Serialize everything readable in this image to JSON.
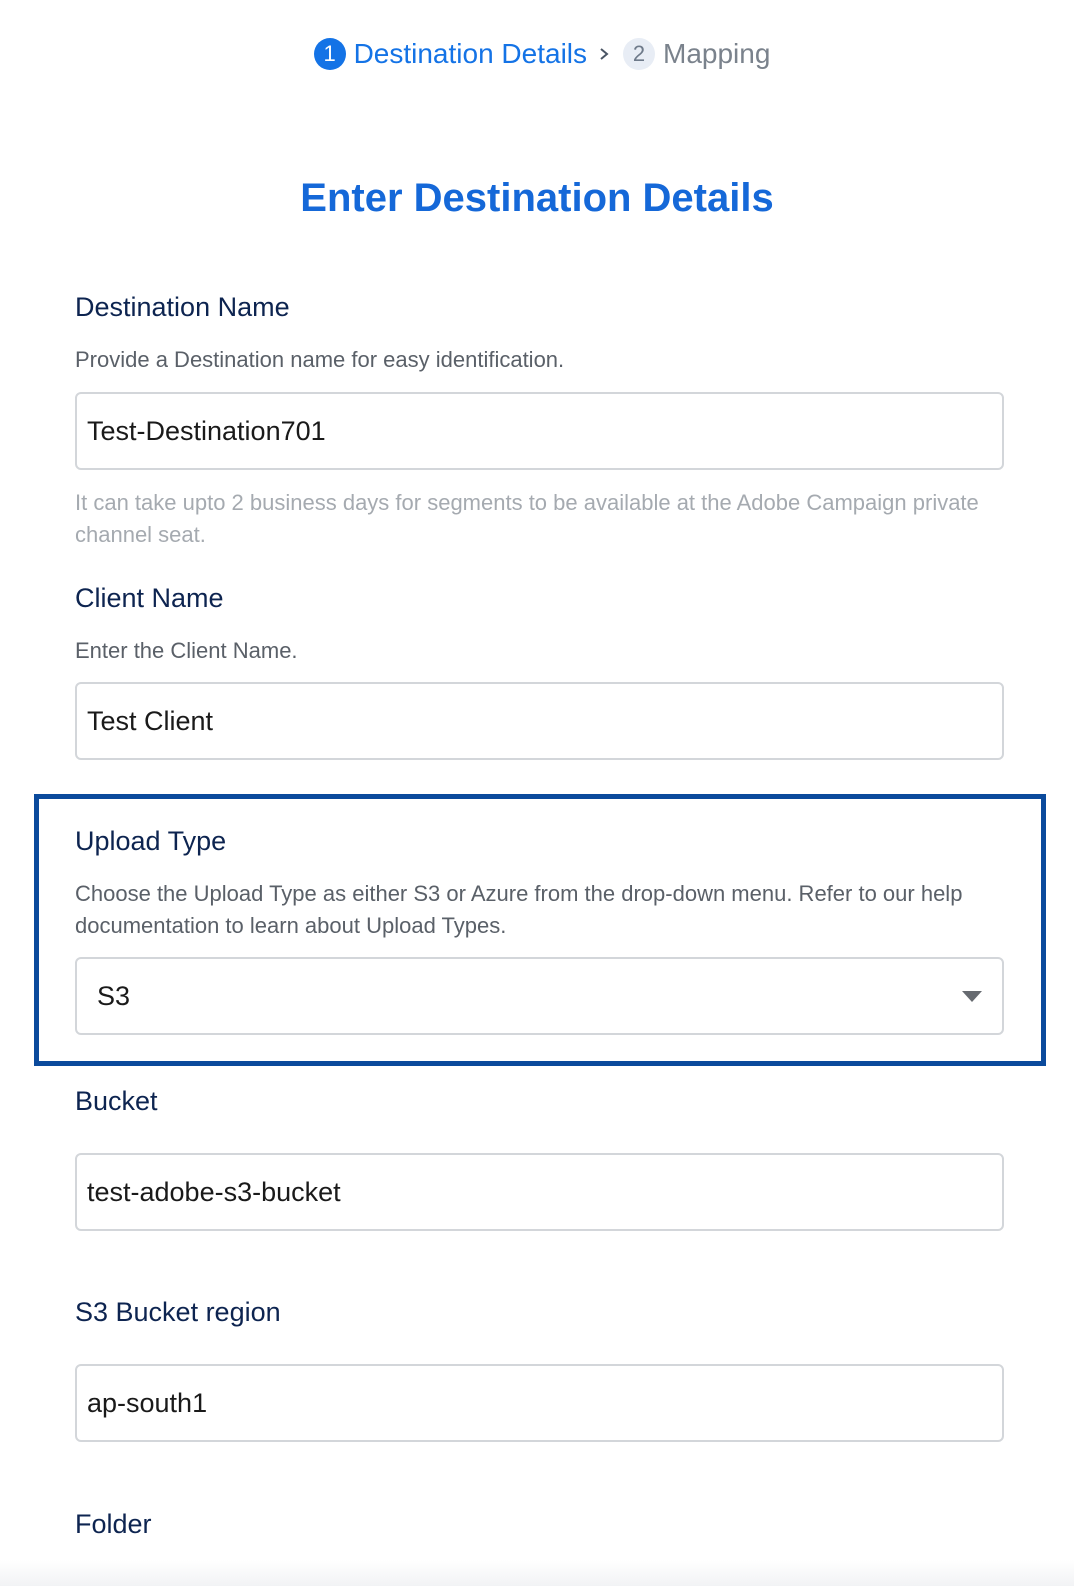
{
  "stepper": {
    "steps": [
      {
        "number": "1",
        "label": "Destination Details",
        "state": "active"
      },
      {
        "number": "2",
        "label": "Mapping",
        "state": "inactive"
      }
    ],
    "separator_icon": "chevron-right-icon"
  },
  "title": "Enter Destination Details",
  "fields": {
    "destination_name": {
      "label": "Destination Name",
      "help": "Provide a Destination name for easy identification.",
      "value": "Test-Destination701",
      "note": "It can take upto 2 business days for segments to be available at the Adobe Campaign private channel seat."
    },
    "client_name": {
      "label": "Client Name",
      "help": "Enter the Client Name.",
      "value": "Test Client"
    },
    "upload_type": {
      "label": "Upload Type",
      "help": "Choose the Upload Type as either S3 or Azure from the drop-down menu. Refer to our help documentation to learn about Upload Types.",
      "selected": "S3",
      "caret_icon": "caret-down-icon"
    },
    "bucket": {
      "label": "Bucket",
      "value": "test-adobe-s3-bucket"
    },
    "s3_bucket_region": {
      "label": "S3 Bucket region",
      "value": "ap-south1"
    },
    "folder": {
      "label": "Folder"
    }
  },
  "colors": {
    "accent": "#1473e6",
    "title": "#1568d8",
    "label": "#0d2450",
    "highlight_border": "#0b4a9c"
  }
}
